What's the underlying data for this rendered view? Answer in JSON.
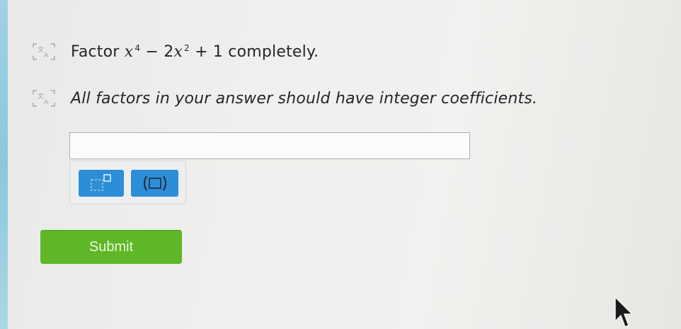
{
  "question": {
    "prompt_prefix": "Factor",
    "var1": "x",
    "exp1": "4",
    "middle": "− 2",
    "var2": "x",
    "exp2": "2",
    "suffix": "+ 1 completely.",
    "instruction": "All factors in your answer should have integer coefficients."
  },
  "answer": {
    "value": "",
    "placeholder": ""
  },
  "toolbar": {
    "buttons": [
      {
        "icon": "superscript-template-icon"
      },
      {
        "icon": "parentheses-template-icon"
      }
    ]
  },
  "submit": {
    "label": "Submit"
  },
  "colors": {
    "tool_button": "#2c8ed6",
    "submit_button": "#5fb728",
    "icon_gray": "#a9b4bf"
  }
}
